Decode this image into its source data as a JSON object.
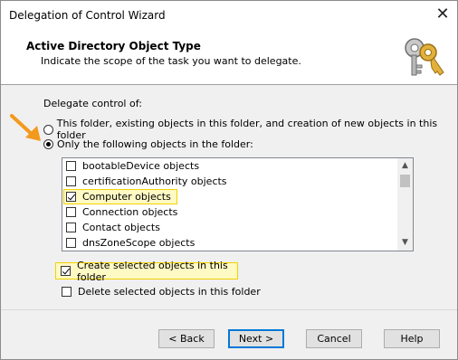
{
  "window": {
    "title": "Delegation of Control Wizard",
    "close_glyph": "✕"
  },
  "header": {
    "title": "Active Directory Object Type",
    "subtitle": "Indicate the scope of the task you want to delegate.",
    "icon": "keys-icon"
  },
  "delegate_label": "Delegate control of:",
  "radios": [
    {
      "label": "This folder, existing objects in this folder, and creation of new objects in this folder",
      "selected": false
    },
    {
      "label": "Only the following objects in the folder:",
      "selected": true
    }
  ],
  "object_list": [
    {
      "label": "bootableDevice objects",
      "checked": false
    },
    {
      "label": "certificationAuthority objects",
      "checked": false
    },
    {
      "label": "Computer objects",
      "checked": true
    },
    {
      "label": "Connection objects",
      "checked": false
    },
    {
      "label": "Contact objects",
      "checked": false
    },
    {
      "label": "dnsZoneScope objects",
      "checked": false
    }
  ],
  "options": [
    {
      "label": "Create selected objects in this folder",
      "checked": true
    },
    {
      "label": "Delete selected objects in this folder",
      "checked": false
    }
  ],
  "buttons": {
    "back": "< Back",
    "next": "Next >",
    "cancel": "Cancel",
    "help": "Help"
  },
  "accent": {
    "annotation_arrow": "#f39a1e",
    "highlight_border": "#f2d200",
    "highlight_fill": "#fff9c4",
    "default_button_border": "#0078d7"
  }
}
